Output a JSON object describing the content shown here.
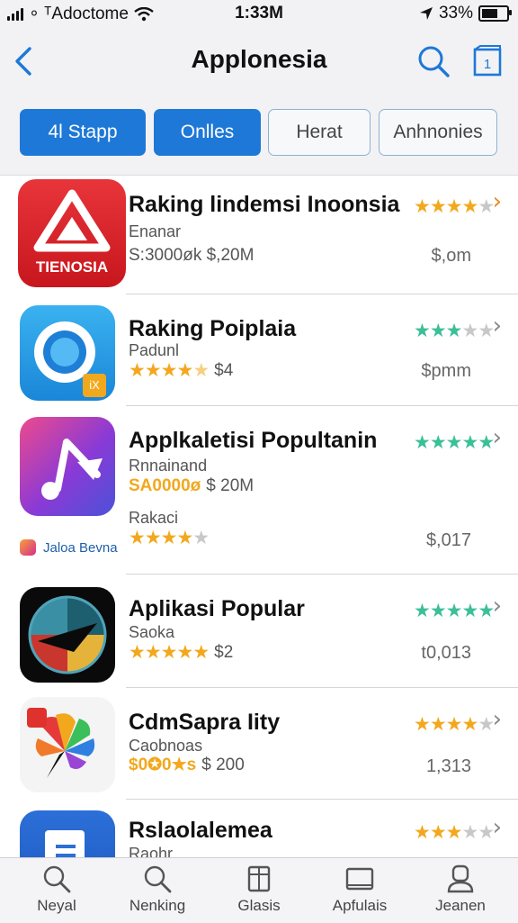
{
  "status": {
    "carrier": "∘ ᵀAdoctome",
    "time": "1:33M",
    "battery": "33%",
    "battery_level": 0.75
  },
  "navbar": {
    "back": "back",
    "title": "Applonesia"
  },
  "filters": [
    {
      "label": "4l Stapp",
      "active": true
    },
    {
      "label": "Onlles",
      "active": true
    },
    {
      "label": "Herat",
      "active": false
    },
    {
      "label": "Anhnonies",
      "active": false
    }
  ],
  "apps": [
    {
      "name": "Raking lindemsi Inoonsia",
      "sub": "Enanar",
      "meta": "S:3000øk $,20M",
      "rating_stars": 3.5,
      "rating_color": "gold",
      "price": "$,om",
      "icon_text": "TIENOSIA"
    },
    {
      "name": "Raking Poiplaia",
      "sub": "Padunl",
      "meta": "$4",
      "meta_stars": 4.5,
      "rating_stars": 3,
      "rating_color": "teal",
      "price": "$pmm",
      "badge": "iX"
    },
    {
      "name": "Applkaletisi Popultanin",
      "sub": "Rnnainand",
      "meta_gold": "SA0000ø",
      "meta": "$ 20M",
      "sub2": "Rakaci",
      "meta2_stars": 4,
      "rating_stars": 5,
      "rating_color": "teal",
      "price": "$,017",
      "caption": "Jaloa Bevna"
    },
    {
      "name": "Aplikasi Popular",
      "sub": "Saoka",
      "meta": "$2",
      "meta_stars": 5,
      "rating_stars": 5,
      "rating_color": "teal",
      "price": "t0,013"
    },
    {
      "name": "CdmSapra Iity",
      "sub": "Caobnoas",
      "meta_gold": "$0✪0★s",
      "meta": "$ 200",
      "rating_stars": 3.5,
      "rating_color": "gold",
      "price": "1,313"
    },
    {
      "name": "Rslaolalemea",
      "sub": "Raohr",
      "rating_stars": 3,
      "rating_color": "gold"
    }
  ],
  "tabs": [
    {
      "label": "Neyal",
      "icon": "search-icon"
    },
    {
      "label": "Nenking",
      "icon": "search-icon"
    },
    {
      "label": "Glasis",
      "icon": "book-icon"
    },
    {
      "label": "Apfulais",
      "icon": "tray-icon"
    },
    {
      "label": "Jeanen",
      "icon": "profile-icon"
    }
  ]
}
